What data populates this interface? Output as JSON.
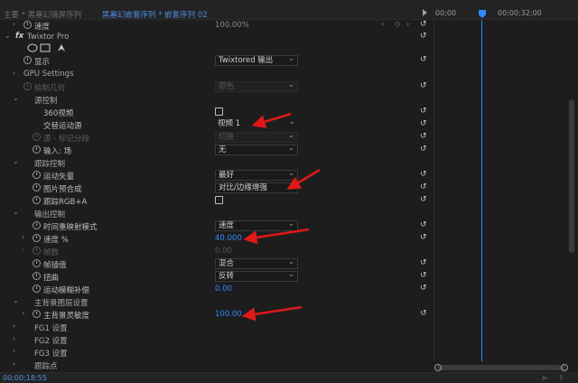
{
  "header": {
    "source_tab": "主要 * 黑塞幻镜屏序列",
    "sequence_tab": "黑塞幻嵌套序列 * 嵌套序列 02",
    "timecode_start": "00;00",
    "timecode_end": "00;00;32;00"
  },
  "rows": [
    {
      "label": "速度",
      "value": "100.00%",
      "kind": "value_text"
    },
    {
      "label": "Twixtor Pro",
      "kind": "fx"
    },
    {
      "label": "",
      "kind": "shapes",
      "icons": [
        "ellipse-mask-icon",
        "rectangle-mask-icon",
        "pen-mask-icon"
      ]
    },
    {
      "label": "显示",
      "dropdown": "Twixtored 输出",
      "kind": "dropdown"
    },
    {
      "label": "GPU Settings",
      "kind": "group"
    },
    {
      "label": "绘制几何",
      "dropdown": "颜色",
      "kind": "dropdown_dim"
    },
    {
      "label": "源控制",
      "kind": "group"
    },
    {
      "label": "360视频",
      "kind": "checkbox"
    },
    {
      "label": "交替运动源",
      "dropdown": "视频 1",
      "kind": "dropdown"
    },
    {
      "label": "源 - 标记分段",
      "dropdown": "切换",
      "kind": "dropdown_dim"
    },
    {
      "label": "输入: 场",
      "dropdown": "无",
      "kind": "dropdown"
    },
    {
      "label": "跟踪控制",
      "kind": "group"
    },
    {
      "label": "运动矢量",
      "dropdown": "最好",
      "kind": "dropdown"
    },
    {
      "label": "图片预合成",
      "dropdown": "对比/边缘增强",
      "kind": "dropdown"
    },
    {
      "label": "跟踪RGB+A",
      "kind": "checkbox"
    },
    {
      "label": "输出控制",
      "kind": "group"
    },
    {
      "label": "时间重映射模式",
      "dropdown": "速度",
      "kind": "dropdown"
    },
    {
      "label": "速度 %",
      "value": "40.000",
      "kind": "value"
    },
    {
      "label": "帧数",
      "value": "0.00",
      "kind": "value_dim"
    },
    {
      "label": "帧插值",
      "dropdown": "混合",
      "kind": "dropdown"
    },
    {
      "label": "扭曲",
      "dropdown": "反转",
      "kind": "dropdown"
    },
    {
      "label": "运动模糊补偿",
      "value": "0.00",
      "kind": "value"
    },
    {
      "label": "主背景图层设置",
      "kind": "group"
    },
    {
      "label": "主背景灵敏度",
      "value": "100.00",
      "kind": "value"
    },
    {
      "label": "FG1 设置",
      "kind": "group"
    },
    {
      "label": "FG2 设置",
      "kind": "group"
    },
    {
      "label": "FG3 设置",
      "kind": "group"
    },
    {
      "label": "跟踪点",
      "kind": "group"
    }
  ],
  "footer": {
    "timecode": "00;00;18;55"
  },
  "colors": {
    "accent": "#2f8bff",
    "arrow": "#e01818",
    "background": "#1d1d1d"
  }
}
